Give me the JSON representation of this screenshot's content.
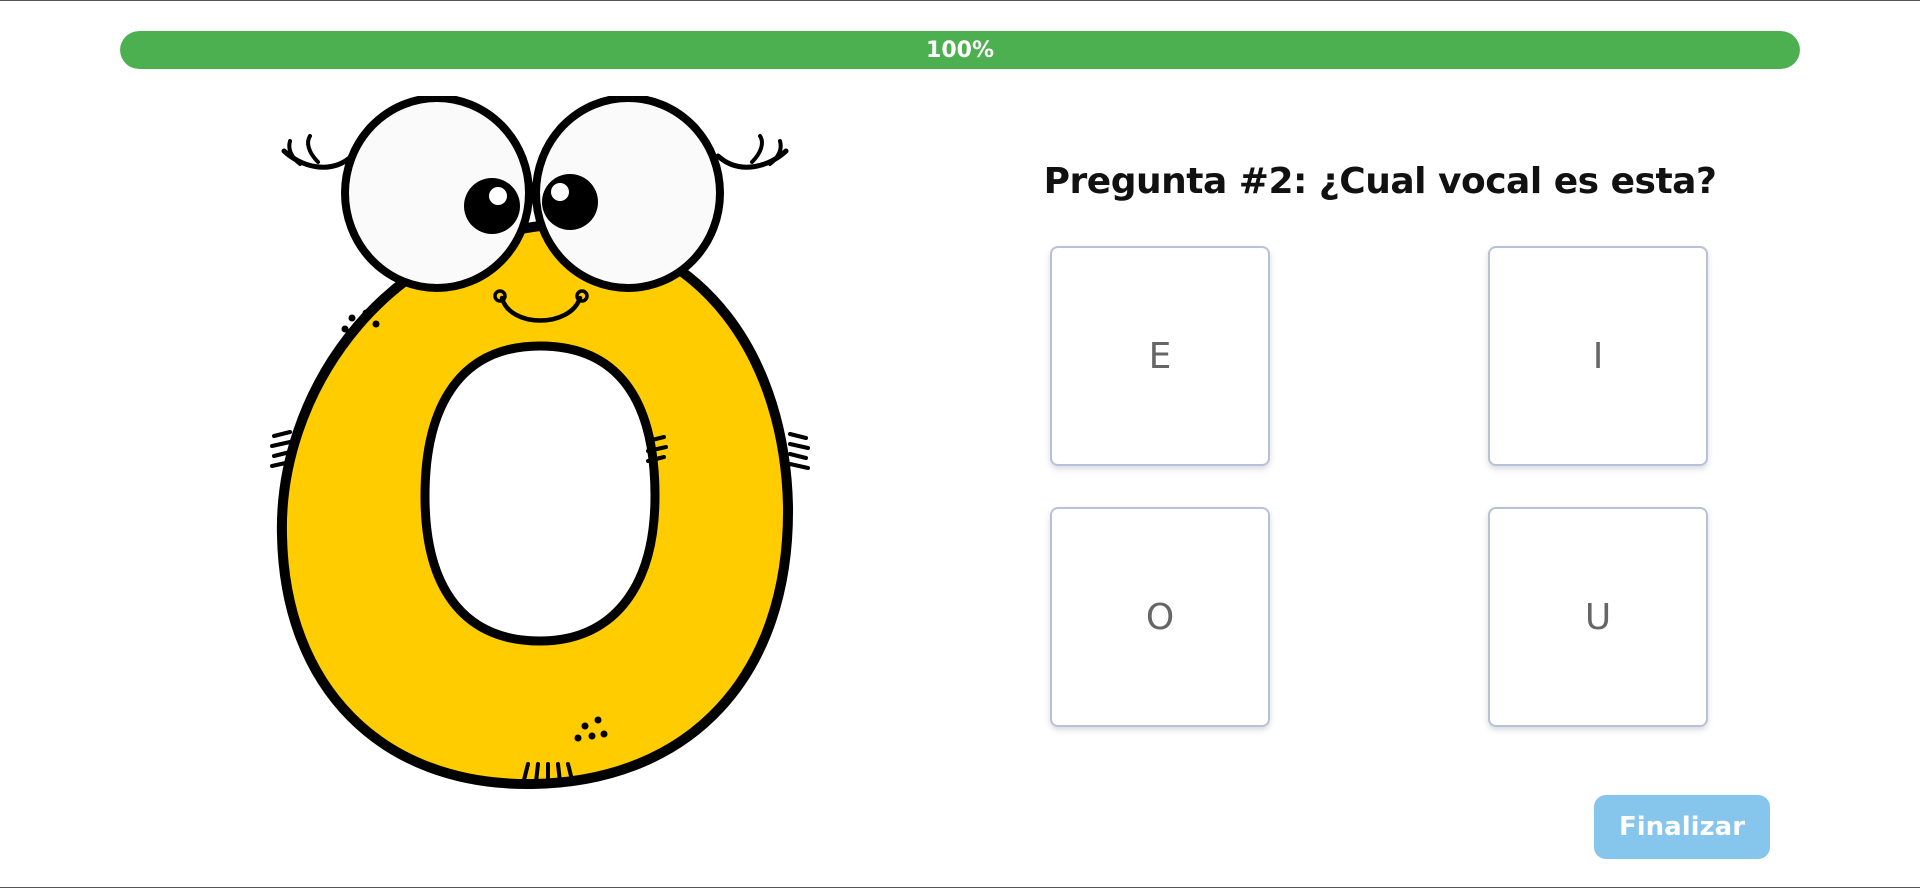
{
  "progress": {
    "value_percent": 100,
    "label": "100%",
    "color": "#4caf50"
  },
  "illustration": {
    "subject": "letter-o-monster-icon",
    "body_color": "#ffcc00"
  },
  "question": {
    "text": "Pregunta #2: ¿Cual vocal es esta?"
  },
  "options": [
    {
      "label": "E"
    },
    {
      "label": "I"
    },
    {
      "label": "O"
    },
    {
      "label": "U"
    }
  ],
  "finish_button": {
    "label": "Finalizar",
    "color": "#86c5ec"
  }
}
